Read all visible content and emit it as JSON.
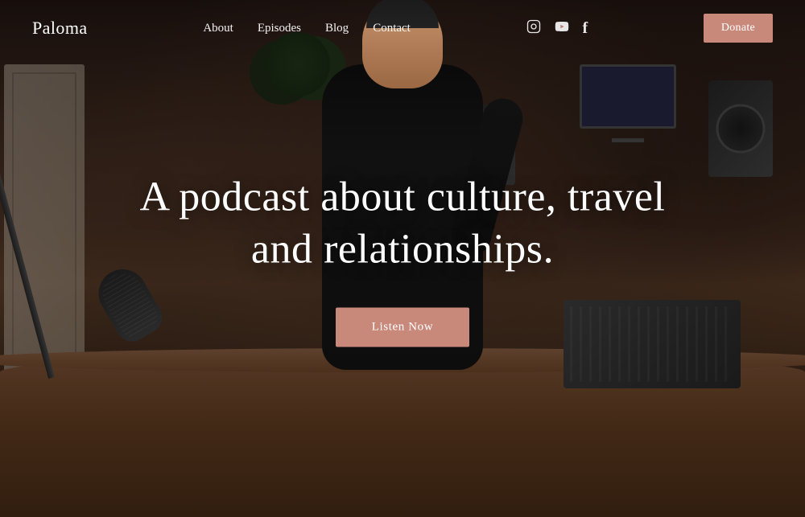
{
  "brand": {
    "logo": "Paloma"
  },
  "nav": {
    "links": [
      {
        "label": "About",
        "id": "about"
      },
      {
        "label": "Episodes",
        "id": "episodes"
      },
      {
        "label": "Blog",
        "id": "blog"
      },
      {
        "label": "Contact",
        "id": "contact"
      }
    ],
    "icons": [
      {
        "name": "instagram-icon",
        "symbol": "📷"
      },
      {
        "name": "youtube-icon",
        "symbol": "▶"
      },
      {
        "name": "facebook-icon",
        "symbol": "f"
      }
    ],
    "donate_label": "Donate"
  },
  "hero": {
    "tagline": "A podcast about culture, travel and relationships.",
    "cta_label": "Listen Now"
  },
  "colors": {
    "accent": "#c9897a",
    "text_white": "#ffffff",
    "bg_dark": "#1a1210"
  }
}
